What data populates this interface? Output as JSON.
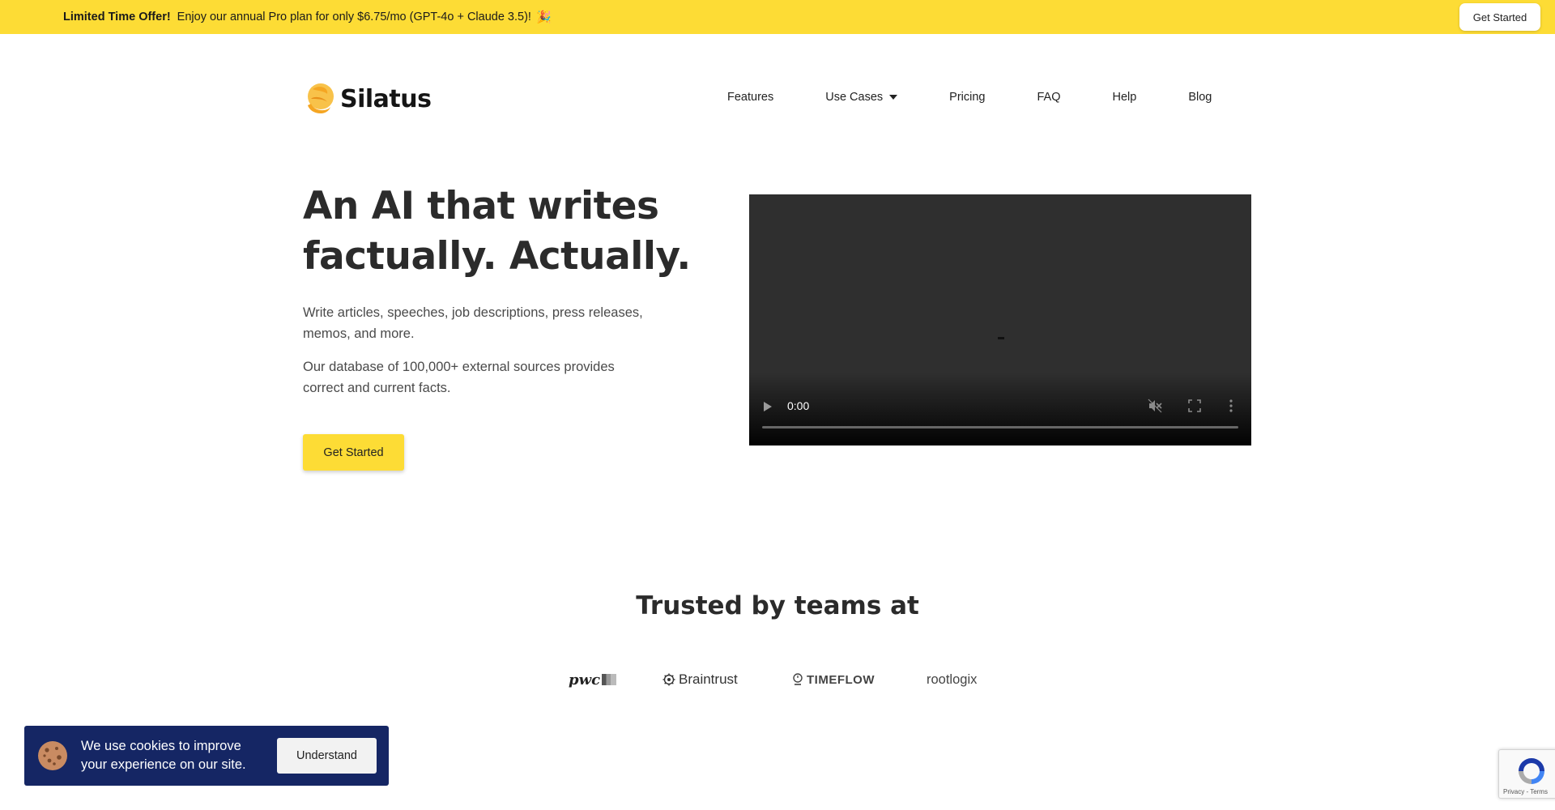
{
  "promo": {
    "strong": "Limited Time Offer!",
    "text": "Enjoy our annual Pro plan for only $6.75/mo (GPT-4o + Claude 3.5)!",
    "emoji": "🎉",
    "button": "Get Started"
  },
  "header": {
    "logo_text": "Silatus",
    "nav": [
      "Features",
      "Use Cases",
      "Pricing",
      "FAQ",
      "Help",
      "Blog"
    ]
  },
  "hero": {
    "title": "An AI that writes factually. Actually.",
    "paragraph1": "Write articles, speeches, job descriptions, press releases, memos, and more.",
    "paragraph2": "Our database of 100,000+ external sources provides correct and current facts.",
    "cta": "Get Started"
  },
  "video": {
    "time": "0:00",
    "icons": [
      "play-icon",
      "mute-icon",
      "fullscreen-icon",
      "more-options-icon"
    ]
  },
  "trusted": {
    "title": "Trusted by teams at",
    "brands": [
      "pwc",
      "Braintrust",
      "TIMEFLOW",
      "rootlogix"
    ]
  },
  "cookie": {
    "text": "We use cookies to improve your experience on our site.",
    "button": "Understand"
  },
  "recaptcha": {
    "text": "Privacy - Terms"
  },
  "colors": {
    "accent": "#fddc35",
    "cookie_bg": "#152664",
    "logo": "#f5a623"
  }
}
